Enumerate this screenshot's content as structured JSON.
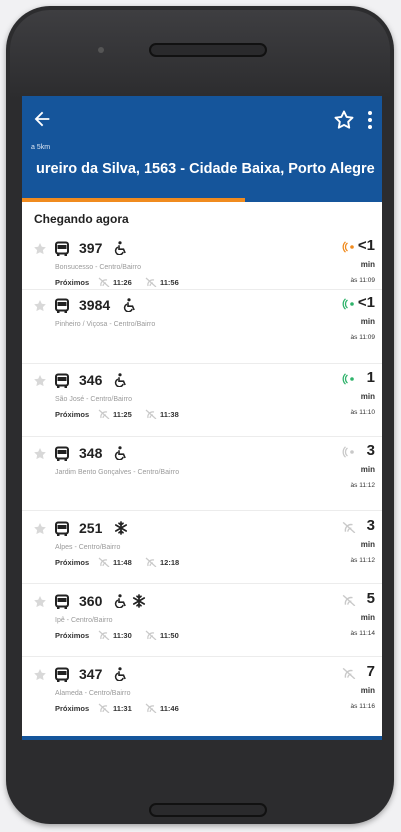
{
  "header": {
    "distance": "a 5km",
    "address": "ureiro da Silva, 1563 - Cidade Baixa, Porto Alegre",
    "colors": {
      "appbar": "#15559b",
      "accent": "#f08b1f"
    }
  },
  "section_title": "Chegando agora",
  "next_label": "Próximos",
  "arrivals": [
    {
      "line": "397",
      "route": "Bonsucesso - Centro/Bairro",
      "next": [
        "11:26",
        "11:56"
      ],
      "eta": "<1",
      "unit": "min",
      "at": "às 11:09",
      "signal": "live-orange",
      "wheelchair": true,
      "ac": false
    },
    {
      "line": "3984",
      "route": "Pinheiro / Viçosa - Centro/Bairro",
      "next": [],
      "eta": "<1",
      "unit": "min",
      "at": "às 11:09",
      "signal": "live-green",
      "wheelchair": true,
      "ac": false
    },
    {
      "line": "346",
      "route": "São José - Centro/Bairro",
      "next": [
        "11:25",
        "11:38"
      ],
      "eta": "1",
      "unit": "min",
      "at": "às 11:10",
      "signal": "live-green",
      "wheelchair": true,
      "ac": false
    },
    {
      "line": "348",
      "route": "Jardim Bento Gonçalves - Centro/Bairro",
      "next": [],
      "eta": "3",
      "unit": "min",
      "at": "às 11:12",
      "signal": "live-gray",
      "wheelchair": true,
      "ac": false
    },
    {
      "line": "251",
      "route": "Alpes - Centro/Bairro",
      "next": [
        "11:48",
        "12:18"
      ],
      "eta": "3",
      "unit": "min",
      "at": "às 11:12",
      "signal": "scheduled",
      "wheelchair": false,
      "ac": true
    },
    {
      "line": "360",
      "route": "Ipê - Centro/Bairro",
      "next": [
        "11:30",
        "11:50"
      ],
      "eta": "5",
      "unit": "min",
      "at": "às 11:14",
      "signal": "scheduled",
      "wheelchair": true,
      "ac": true
    },
    {
      "line": "347",
      "route": "Alameda - Centro/Bairro",
      "next": [
        "11:31",
        "11:46"
      ],
      "eta": "7",
      "unit": "min",
      "at": "às 11:16",
      "signal": "scheduled",
      "wheelchair": true,
      "ac": false
    }
  ],
  "icons": {
    "back": "arrow-left-icon",
    "favorite": "star-outline-icon",
    "more": "more-vert-icon",
    "bus": "bus-icon",
    "wheelchair": "wheelchair-icon",
    "ac": "snowflake-icon",
    "realtime": "signal-icon",
    "scheduled": "no-signal-icon"
  }
}
